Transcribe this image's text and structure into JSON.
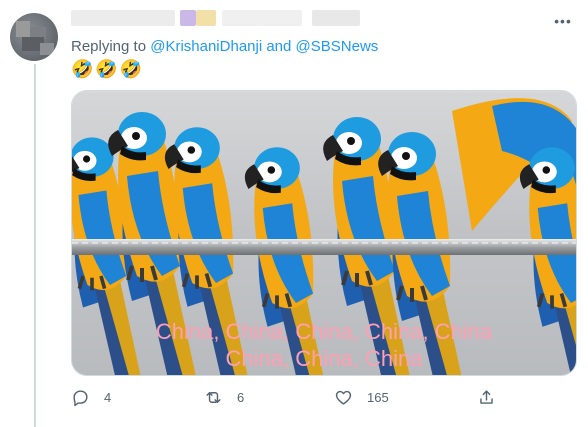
{
  "reply": {
    "prefix": "Replying to",
    "mention1": "@KrishaniDhanji",
    "joiner": "and",
    "mention2": "@SBSNews"
  },
  "tweet": {
    "emojis": [
      "🤣",
      "🤣",
      "🤣"
    ],
    "more_label": "•••"
  },
  "media": {
    "caption_line1": "China, China, China, China, China",
    "caption_line2": "China, China, China",
    "caption_color": "#ff9fb3"
  },
  "actions": {
    "reply_count": "4",
    "retweet_count": "6",
    "like_count": "165",
    "icons": [
      "reply-icon",
      "retweet-icon",
      "like-icon",
      "share-icon"
    ]
  },
  "colors": {
    "mention": "#1d9bf0",
    "muted": "#536471",
    "line": "#cfd9de"
  }
}
